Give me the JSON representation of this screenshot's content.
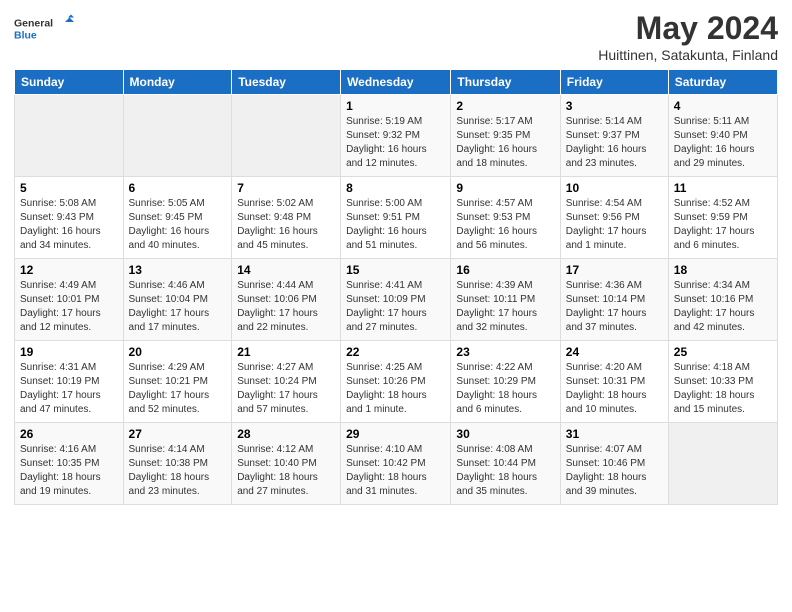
{
  "header": {
    "logo_general": "General",
    "logo_blue": "Blue",
    "month_title": "May 2024",
    "location": "Huittinen, Satakunta, Finland"
  },
  "weekdays": [
    "Sunday",
    "Monday",
    "Tuesday",
    "Wednesday",
    "Thursday",
    "Friday",
    "Saturday"
  ],
  "weeks": [
    [
      {
        "day": "",
        "info": ""
      },
      {
        "day": "",
        "info": ""
      },
      {
        "day": "",
        "info": ""
      },
      {
        "day": "1",
        "info": "Sunrise: 5:19 AM\nSunset: 9:32 PM\nDaylight: 16 hours\nand 12 minutes."
      },
      {
        "day": "2",
        "info": "Sunrise: 5:17 AM\nSunset: 9:35 PM\nDaylight: 16 hours\nand 18 minutes."
      },
      {
        "day": "3",
        "info": "Sunrise: 5:14 AM\nSunset: 9:37 PM\nDaylight: 16 hours\nand 23 minutes."
      },
      {
        "day": "4",
        "info": "Sunrise: 5:11 AM\nSunset: 9:40 PM\nDaylight: 16 hours\nand 29 minutes."
      }
    ],
    [
      {
        "day": "5",
        "info": "Sunrise: 5:08 AM\nSunset: 9:43 PM\nDaylight: 16 hours\nand 34 minutes."
      },
      {
        "day": "6",
        "info": "Sunrise: 5:05 AM\nSunset: 9:45 PM\nDaylight: 16 hours\nand 40 minutes."
      },
      {
        "day": "7",
        "info": "Sunrise: 5:02 AM\nSunset: 9:48 PM\nDaylight: 16 hours\nand 45 minutes."
      },
      {
        "day": "8",
        "info": "Sunrise: 5:00 AM\nSunset: 9:51 PM\nDaylight: 16 hours\nand 51 minutes."
      },
      {
        "day": "9",
        "info": "Sunrise: 4:57 AM\nSunset: 9:53 PM\nDaylight: 16 hours\nand 56 minutes."
      },
      {
        "day": "10",
        "info": "Sunrise: 4:54 AM\nSunset: 9:56 PM\nDaylight: 17 hours\nand 1 minute."
      },
      {
        "day": "11",
        "info": "Sunrise: 4:52 AM\nSunset: 9:59 PM\nDaylight: 17 hours\nand 6 minutes."
      }
    ],
    [
      {
        "day": "12",
        "info": "Sunrise: 4:49 AM\nSunset: 10:01 PM\nDaylight: 17 hours\nand 12 minutes."
      },
      {
        "day": "13",
        "info": "Sunrise: 4:46 AM\nSunset: 10:04 PM\nDaylight: 17 hours\nand 17 minutes."
      },
      {
        "day": "14",
        "info": "Sunrise: 4:44 AM\nSunset: 10:06 PM\nDaylight: 17 hours\nand 22 minutes."
      },
      {
        "day": "15",
        "info": "Sunrise: 4:41 AM\nSunset: 10:09 PM\nDaylight: 17 hours\nand 27 minutes."
      },
      {
        "day": "16",
        "info": "Sunrise: 4:39 AM\nSunset: 10:11 PM\nDaylight: 17 hours\nand 32 minutes."
      },
      {
        "day": "17",
        "info": "Sunrise: 4:36 AM\nSunset: 10:14 PM\nDaylight: 17 hours\nand 37 minutes."
      },
      {
        "day": "18",
        "info": "Sunrise: 4:34 AM\nSunset: 10:16 PM\nDaylight: 17 hours\nand 42 minutes."
      }
    ],
    [
      {
        "day": "19",
        "info": "Sunrise: 4:31 AM\nSunset: 10:19 PM\nDaylight: 17 hours\nand 47 minutes."
      },
      {
        "day": "20",
        "info": "Sunrise: 4:29 AM\nSunset: 10:21 PM\nDaylight: 17 hours\nand 52 minutes."
      },
      {
        "day": "21",
        "info": "Sunrise: 4:27 AM\nSunset: 10:24 PM\nDaylight: 17 hours\nand 57 minutes."
      },
      {
        "day": "22",
        "info": "Sunrise: 4:25 AM\nSunset: 10:26 PM\nDaylight: 18 hours\nand 1 minute."
      },
      {
        "day": "23",
        "info": "Sunrise: 4:22 AM\nSunset: 10:29 PM\nDaylight: 18 hours\nand 6 minutes."
      },
      {
        "day": "24",
        "info": "Sunrise: 4:20 AM\nSunset: 10:31 PM\nDaylight: 18 hours\nand 10 minutes."
      },
      {
        "day": "25",
        "info": "Sunrise: 4:18 AM\nSunset: 10:33 PM\nDaylight: 18 hours\nand 15 minutes."
      }
    ],
    [
      {
        "day": "26",
        "info": "Sunrise: 4:16 AM\nSunset: 10:35 PM\nDaylight: 18 hours\nand 19 minutes."
      },
      {
        "day": "27",
        "info": "Sunrise: 4:14 AM\nSunset: 10:38 PM\nDaylight: 18 hours\nand 23 minutes."
      },
      {
        "day": "28",
        "info": "Sunrise: 4:12 AM\nSunset: 10:40 PM\nDaylight: 18 hours\nand 27 minutes."
      },
      {
        "day": "29",
        "info": "Sunrise: 4:10 AM\nSunset: 10:42 PM\nDaylight: 18 hours\nand 31 minutes."
      },
      {
        "day": "30",
        "info": "Sunrise: 4:08 AM\nSunset: 10:44 PM\nDaylight: 18 hours\nand 35 minutes."
      },
      {
        "day": "31",
        "info": "Sunrise: 4:07 AM\nSunset: 10:46 PM\nDaylight: 18 hours\nand 39 minutes."
      },
      {
        "day": "",
        "info": ""
      }
    ]
  ]
}
